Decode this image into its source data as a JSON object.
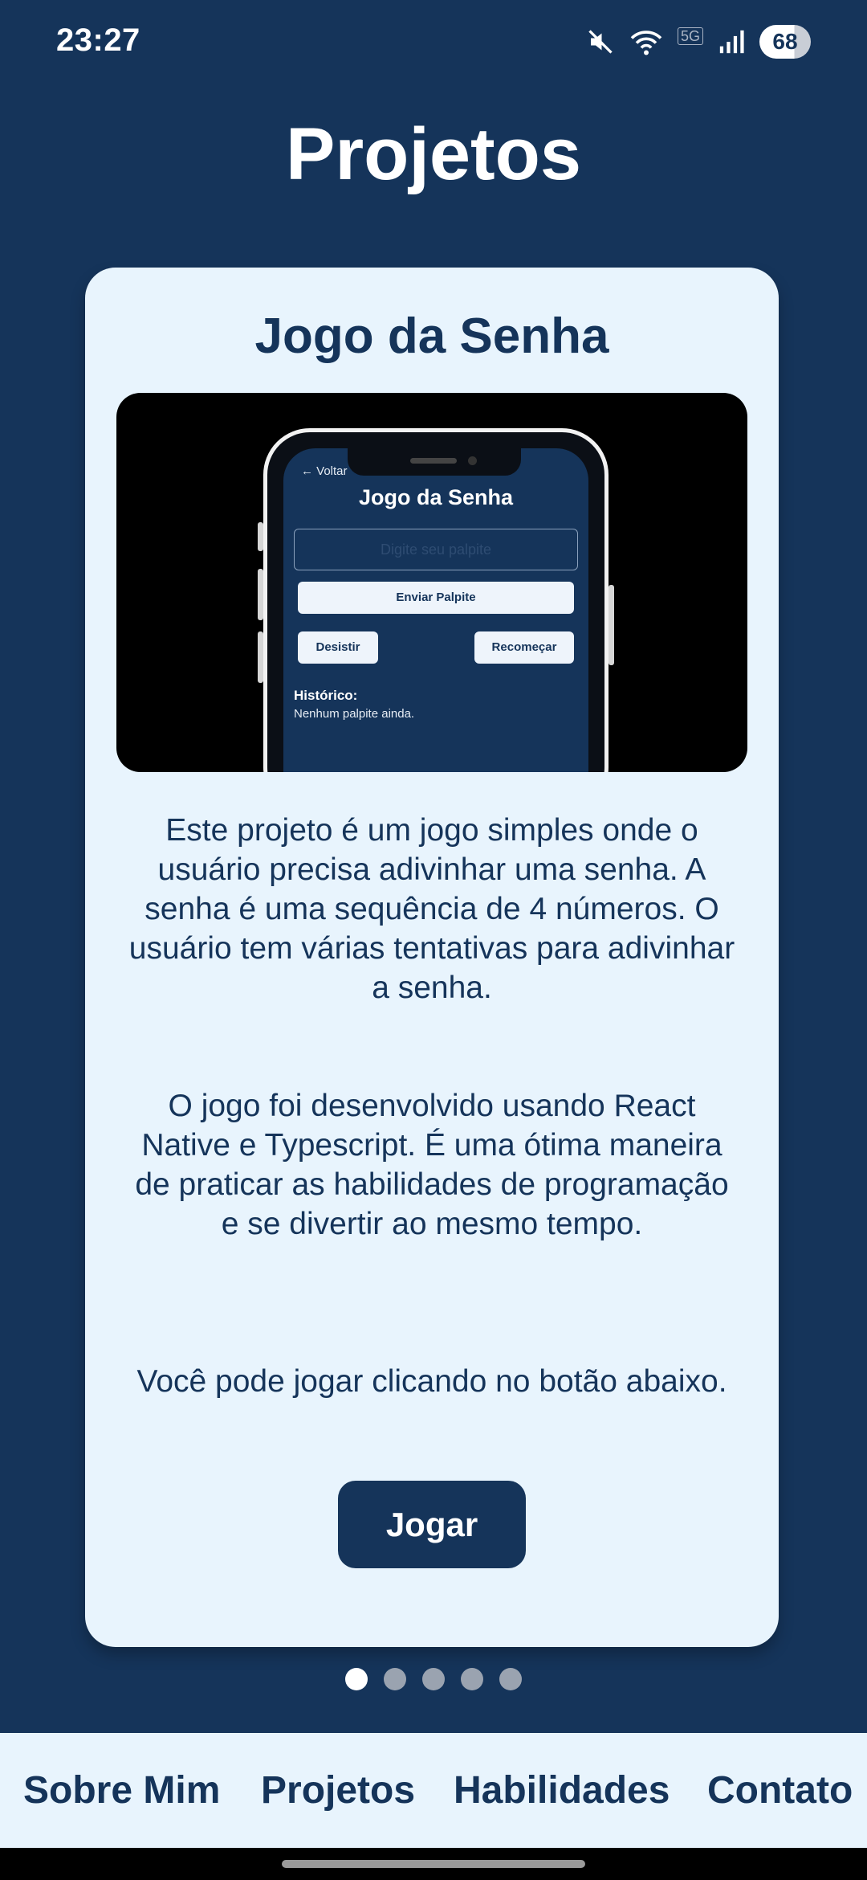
{
  "status_bar": {
    "time": "23:27",
    "network_label": "5G",
    "battery": "68",
    "icons": [
      "mute-icon",
      "wifi-icon",
      "signal-icon",
      "battery-icon"
    ]
  },
  "page": {
    "title": "Projetos"
  },
  "card": {
    "title": "Jogo da Senha",
    "preview": {
      "back": "← Voltar",
      "title": "Jogo da Senha",
      "input_placeholder": "Digite seu palpite",
      "send_button": "Enviar Palpite",
      "quit_button": "Desistir",
      "restart_button": "Recomeçar",
      "history_label": "Histórico:",
      "history_empty": "Nenhum palpite ainda."
    },
    "paragraphs": [
      "Este projeto é um jogo simples onde o usuário precisa adivinhar uma senha. A senha é uma sequência de 4 números. O usuário tem várias tentativas para adivinhar a senha.",
      "O jogo foi desenvolvido usando React Native e Typescript. É uma ótima maneira de praticar as habilidades de programação e se divertir ao mesmo tempo.",
      "Você pode jogar clicando no botão abaixo."
    ],
    "play_button": "Jogar"
  },
  "pagination": {
    "total": 5,
    "active": 1
  },
  "bottom_nav": [
    "Sobre Mim",
    "Projetos",
    "Habilidades",
    "Contato"
  ],
  "colors": {
    "primary": "#15345a",
    "card_bg": "#e8f4fd",
    "dot_inactive": "#9aa3b0"
  }
}
